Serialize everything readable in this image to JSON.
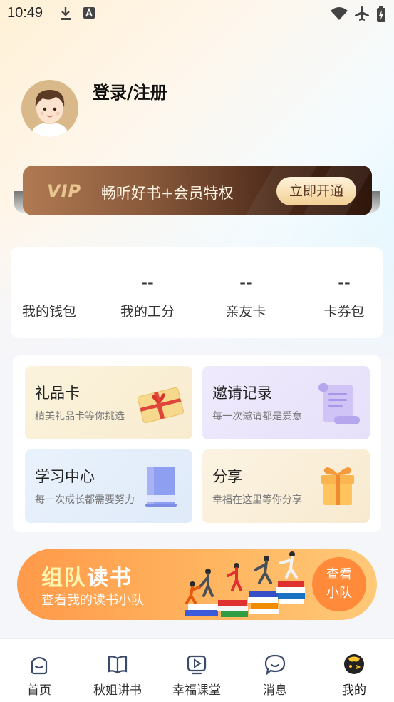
{
  "status_bar": {
    "time": "10:49",
    "icons": [
      "download-icon",
      "text-a-icon",
      "wifi-icon",
      "airplane-icon",
      "battery-icon"
    ]
  },
  "profile": {
    "login_label": "登录/注册"
  },
  "vip_banner": {
    "logo": "VIP",
    "text": "畅听好书+会员特权",
    "button": "立即开通"
  },
  "stats": [
    {
      "value": "",
      "label": "我的钱包"
    },
    {
      "value": "--",
      "label": "我的工分"
    },
    {
      "value": "--",
      "label": "亲友卡"
    },
    {
      "value": "--",
      "label": "卡券包"
    }
  ],
  "features": [
    {
      "title": "礼品卡",
      "subtitle": "精美礼品卡等你挑选",
      "icon": "gift-card-icon",
      "color": "#fbf0d6"
    },
    {
      "title": "邀请记录",
      "subtitle": "每一次邀请都是爱意",
      "icon": "scroll-icon",
      "color": "#ede8fb"
    },
    {
      "title": "学习中心",
      "subtitle": "每一次成长都需要努力",
      "icon": "book-icon",
      "color": "#e6f0fb"
    },
    {
      "title": "分享",
      "subtitle": "幸福在这里等你分享",
      "icon": "gift-box-icon",
      "color": "#fbf1df"
    }
  ],
  "team_banner": {
    "title_a": "组队",
    "title_b": "读书",
    "subtitle": "查看我的读书小队",
    "button_line1": "查看",
    "button_line2": "小队"
  },
  "bottom_nav": [
    {
      "label": "首页",
      "icon": "home-icon"
    },
    {
      "label": "秋姐讲书",
      "icon": "open-book-icon"
    },
    {
      "label": "幸福课堂",
      "icon": "play-icon"
    },
    {
      "label": "消息",
      "icon": "chat-icon"
    },
    {
      "label": "我的",
      "icon": "profile-face-icon",
      "active": true
    }
  ]
}
